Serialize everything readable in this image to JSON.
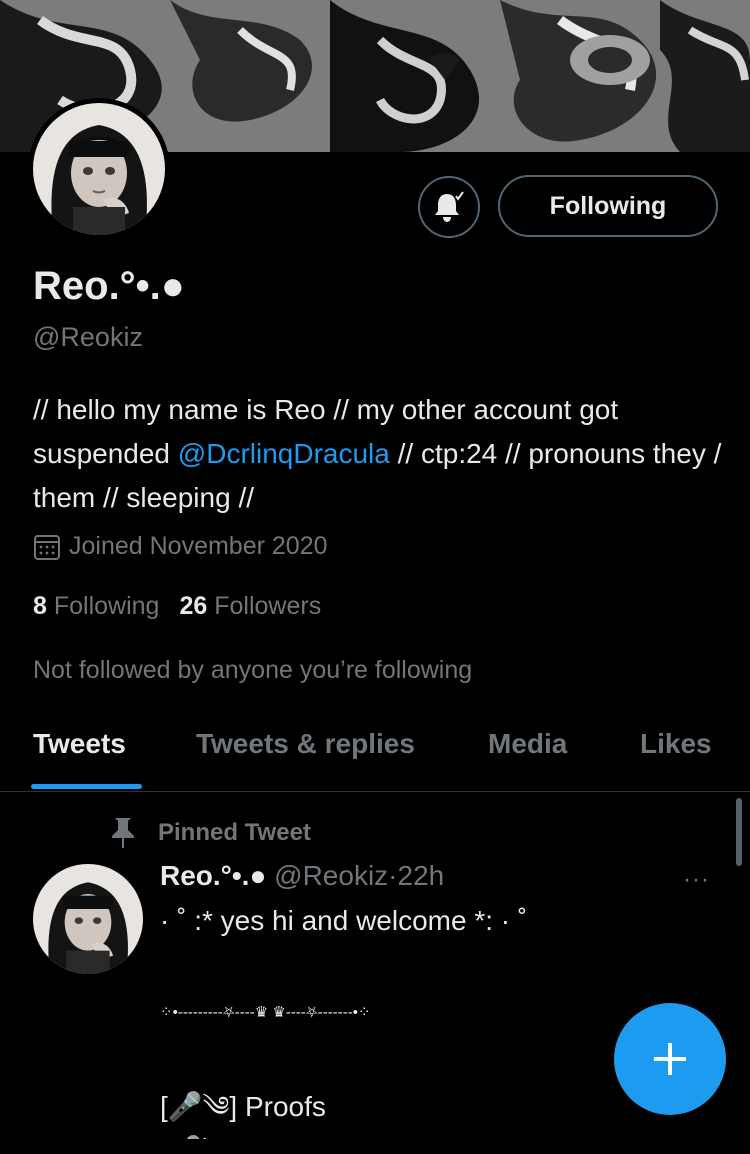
{
  "profile": {
    "name": "Reo.°•.●",
    "handle": "@Reokiz",
    "bio_part1": "// hello my name is Reo // my other account got suspended ",
    "bio_link": "@DcrlinqDracula",
    "bio_part2": " // ctp:24 // pronouns they / them // sleeping //",
    "joined": "Joined November 2020",
    "following_count": "8",
    "following_label": "Following",
    "followers_count": "26",
    "followers_label": "Followers",
    "not_followed": "Not followed by anyone you’re following"
  },
  "actions": {
    "notification_icon": "bell-check-icon",
    "follow_label": "Following"
  },
  "tabs": [
    {
      "label": "Tweets",
      "active": true
    },
    {
      "label": "Tweets & replies",
      "active": false
    },
    {
      "label": "Media",
      "active": false
    },
    {
      "label": "Likes",
      "active": false
    }
  ],
  "pinned_tweet": {
    "pinned_label": "Pinned Tweet",
    "author_name": "Reo.°•.●",
    "author_handle": "@Reokiz",
    "separator": "·",
    "time": "22h",
    "more_icon": "···",
    "line1": "· ˚ :* yes hi and welcome *: · ˚",
    "deco": "⁘•---------⛧----♛ ♛----⛧-------•⁘",
    "proofs": "[🎤༄] Proofs",
    "roblox": "[🎤༄] Roblox group"
  },
  "colors": {
    "accent": "#1d9bf0",
    "background": "#000000",
    "muted_text": "#71767b",
    "border": "#2f3336"
  },
  "compose_icon": "plus-icon"
}
